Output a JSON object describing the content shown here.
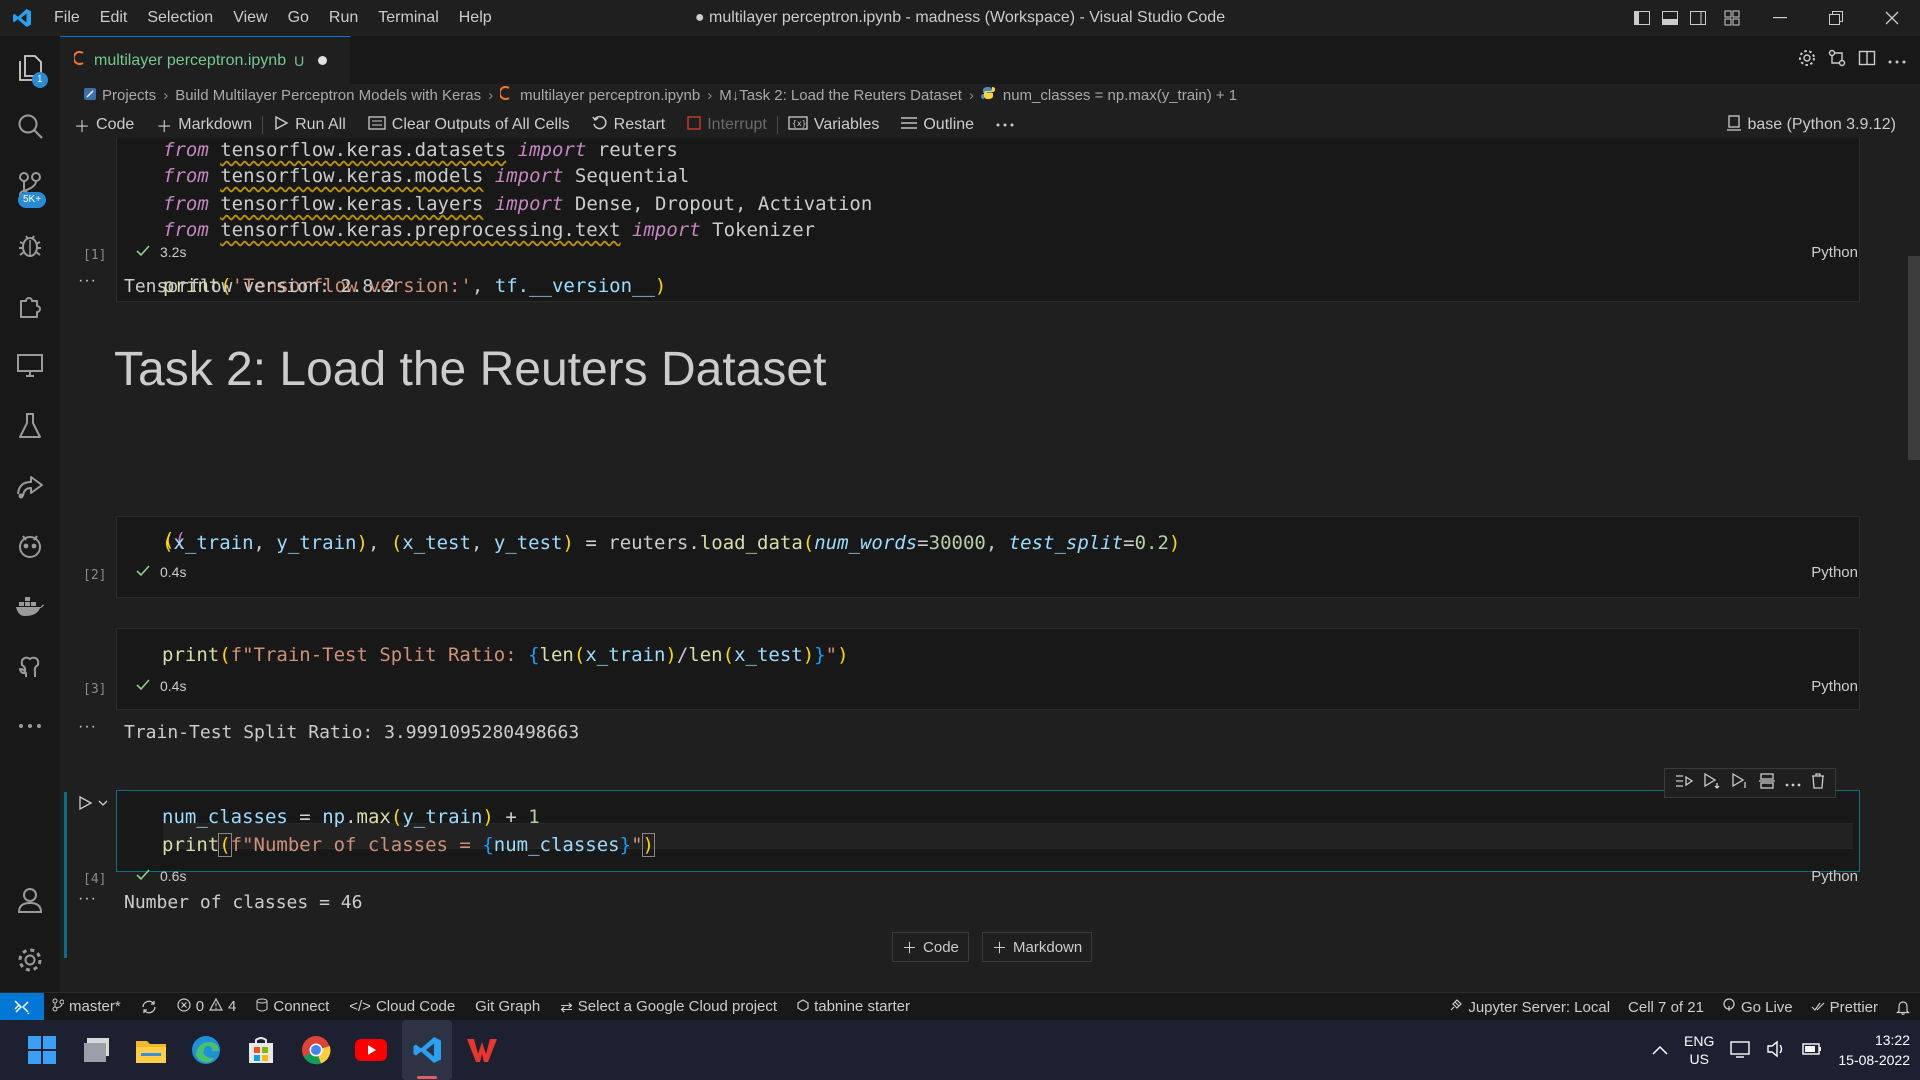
{
  "titlebar": {
    "menu": [
      "File",
      "Edit",
      "Selection",
      "View",
      "Go",
      "Run",
      "Terminal",
      "Help"
    ],
    "title": "● multilayer perceptron.ipynb - madness (Workspace) - Visual Studio Code"
  },
  "activitybar": {
    "explorer_badge": "1",
    "scm_badge": "5K+"
  },
  "tab": {
    "filename": "multilayer perceptron.ipynb",
    "status": "U"
  },
  "breadcrumb": {
    "items": [
      "Projects",
      "Build Multilayer Perceptron Models with Keras",
      "multilayer perceptron.ipynb",
      "M↓Task 2: Load the Reuters Dataset",
      "num_classes = np.max(y_train) + 1"
    ]
  },
  "toolbar": {
    "code": "Code",
    "markdown": "Markdown",
    "run_all": "Run All",
    "clear_outputs": "Clear Outputs of All Cells",
    "restart": "Restart",
    "interrupt": "Interrupt",
    "variables": "Variables",
    "outline": "Outline",
    "kernel": "base (Python 3.9.12)"
  },
  "cells": {
    "cell1": {
      "lines": [
        {
          "kw1": "from",
          "module": "tensorflow.keras.datasets",
          "kw2": "import",
          "name": "reuters"
        },
        {
          "kw1": "from",
          "module": "tensorflow.keras.models",
          "kw2": "import",
          "name": "Sequential"
        },
        {
          "kw1": "from",
          "module": "tensorflow.keras.layers",
          "kw2": "import",
          "name": "Dense, Dropout, Activation"
        },
        {
          "kw1": "from",
          "module": "tensorflow.keras.preprocessing.text",
          "kw2": "import",
          "name": "Tokenizer"
        }
      ],
      "print_fn": "print",
      "print_str": "'Tensorflow version:'",
      "print_var": "tf.__version__",
      "exec_count": "[1]",
      "time": "3.2s",
      "language": "Python",
      "output": "Tensorflow version: 2.8.2"
    },
    "markdown_heading": "Task 2: Load the Reuters Dataset",
    "cell2": {
      "lhs1": "x_train",
      "lhs2": "y_train",
      "lhs3": "x_test",
      "lhs4": "y_test",
      "obj": "reuters",
      "method": "load_data",
      "arg1": "num_words",
      "val1": "30000",
      "arg2": "test_split",
      "val2": "0.2",
      "exec_count": "[2]",
      "time": "0.4s",
      "language": "Python"
    },
    "cell3": {
      "fn": "print",
      "fstr_prefix": "f\"Train-Test Split Ratio: ",
      "len_fn": "len",
      "a": "x_train",
      "b": "x_test",
      "exec_count": "[3]",
      "time": "0.4s",
      "language": "Python",
      "output": "Train-Test Split Ratio: 3.9991095280498663"
    },
    "cell4": {
      "var": "num_classes",
      "np": "np",
      "max": "max",
      "arg": "y_train",
      "one": "1",
      "fn": "print",
      "fstr_prefix": "f\"Number of classes = ",
      "exec_count": "[4]",
      "time": "0.6s",
      "language": "Python",
      "output": "Number of classes = 46"
    }
  },
  "add_cell": {
    "code": "Code",
    "markdown": "Markdown"
  },
  "statusbar": {
    "branch": "master*",
    "errors": "0",
    "warnings": "4",
    "connect": "Connect",
    "cloud_code": "Cloud Code",
    "git_graph": "Git Graph",
    "gcp": "Select a Google Cloud project",
    "tabnine": "tabnine starter",
    "jupyter": "Jupyter Server: Local",
    "cell_pos": "Cell 7 of 21",
    "go_live": "Go Live",
    "prettier": "Prettier"
  },
  "taskbar": {
    "lang_top": "ENG",
    "lang_bottom": "US",
    "time": "13:22",
    "date": "15-08-2022"
  },
  "colors": {
    "accent": "#0078d4",
    "focus_border": "#0a6e88",
    "untracked": "#73c991"
  }
}
